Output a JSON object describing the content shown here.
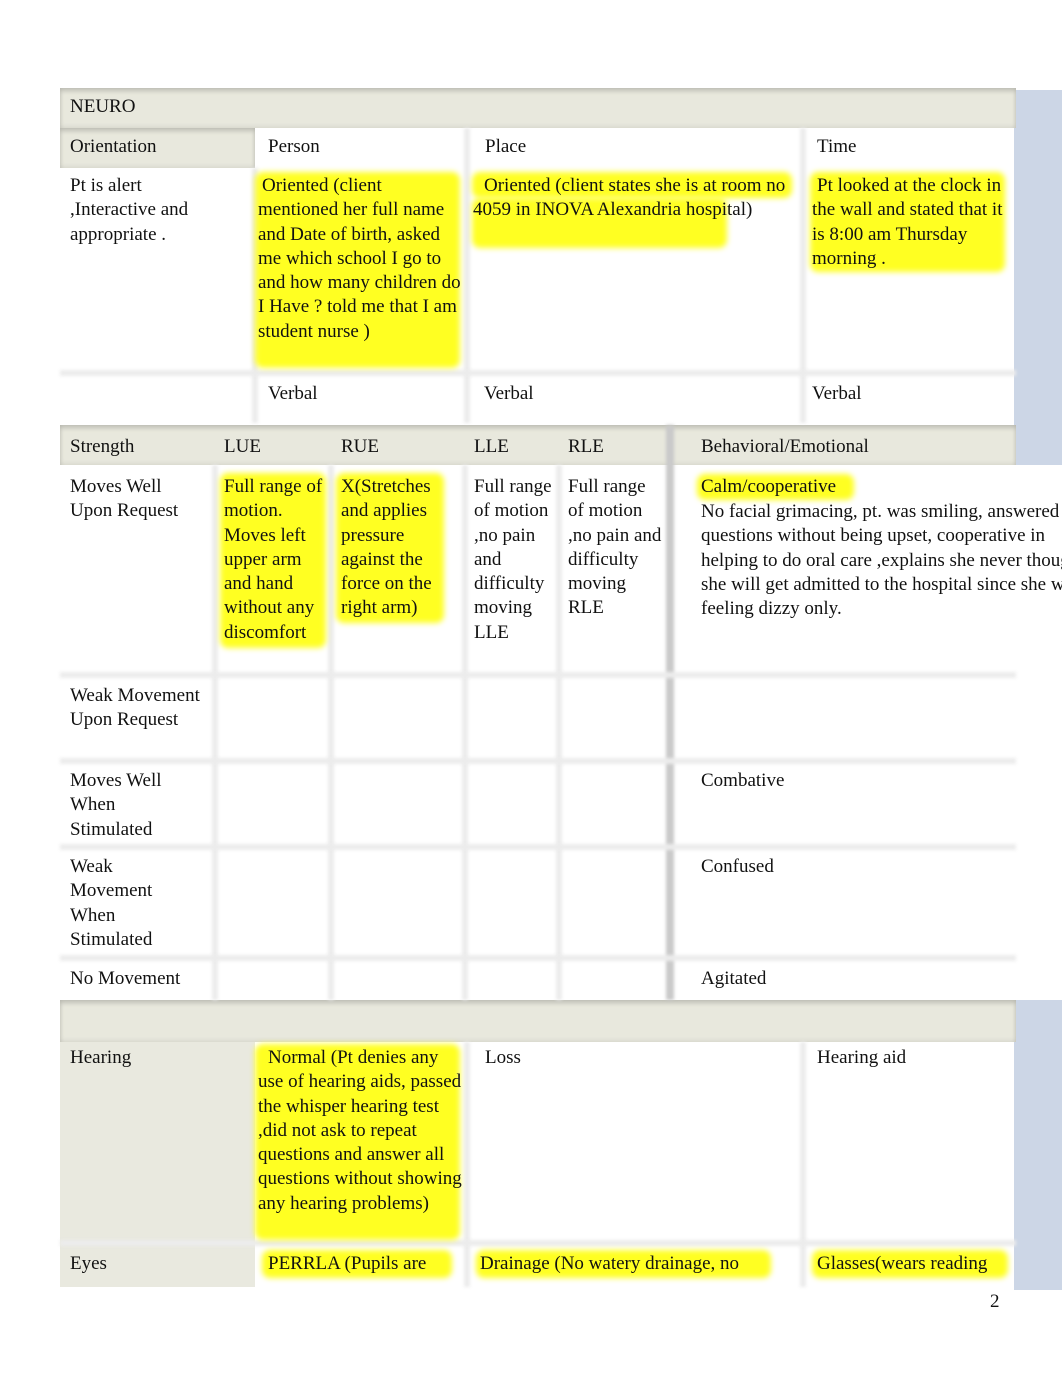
{
  "section_title": "NEURO",
  "orientation": {
    "label": "Orientation",
    "columns": [
      "Person",
      "Place",
      "Time"
    ],
    "summary": "Pt is alert ,Interactive and appropriate .",
    "person": "Oriented (client mentioned her full name and Date of birth, asked me which school I go to and how many children do I Have ? told me that I am student nurse )",
    "place": "Oriented (client states she is at room no 4059 in INOVA Alexandria hospital)",
    "time": "Pt looked at the clock in the wall and stated that it is 8:00 am Thursday morning .",
    "verbal": [
      "Verbal",
      "Verbal",
      "Verbal"
    ]
  },
  "strength": {
    "label": "Strength",
    "columns": [
      "LUE",
      "RUE",
      "LLE",
      "RLE"
    ],
    "behavioral_label": "Behavioral/Emotional",
    "rows": [
      {
        "label": "Moves Well Upon Request",
        "lue": "Full range of motion. Moves left upper arm and hand without any discomfort",
        "rue": "X(Stretches and applies pressure against the force on the right arm)",
        "lle": "Full range of motion ,no pain and difficulty moving LLE",
        "rle": "Full range of motion ,no pain and difficulty moving RLE",
        "behavioral": "Calm/cooperative",
        "behavioral_note": "No facial grimacing, pt. was smiling, answered questions without being upset, cooperative in helping to do oral care ,explains she never thought she will get admitted to the hospital since she was feeling dizzy only."
      },
      {
        "label": "Weak Movement Upon Request",
        "behavioral": ""
      },
      {
        "label": "Moves Well When Stimulated",
        "behavioral": "Combative"
      },
      {
        "label": "Weak Movement When Stimulated",
        "behavioral": "Confused"
      },
      {
        "label": "No Movement",
        "behavioral": "Agitated"
      }
    ]
  },
  "hearing": {
    "label": "Hearing",
    "normal": "Normal (Pt denies any use of hearing aids, passed the whisper hearing test ,did not ask to repeat questions and answer all questions without showing any hearing problems)",
    "loss": "Loss",
    "aid": "Hearing aid"
  },
  "eyes": {
    "label": "Eyes",
    "perrla": "PERRLA (Pupils are",
    "drainage": "Drainage (No watery drainage, no",
    "glasses": "Glasses(wears reading"
  },
  "page_number": "2"
}
